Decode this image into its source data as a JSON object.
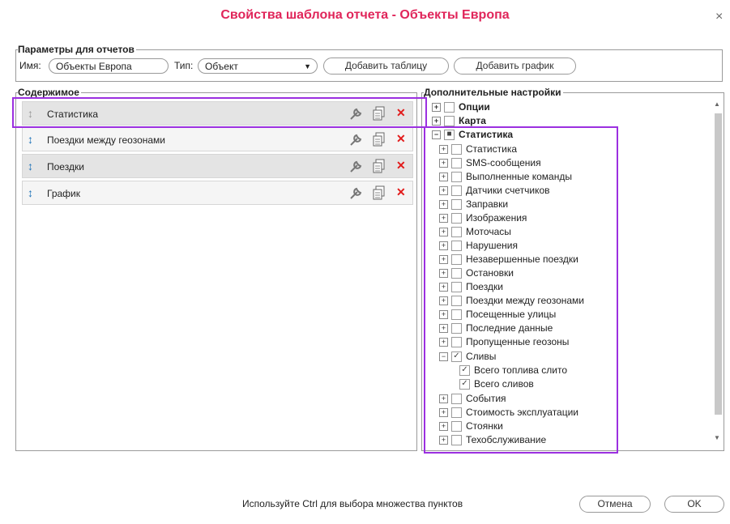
{
  "dialog": {
    "title": "Свойства шаблона отчета - Объекты Европа",
    "close": "×"
  },
  "params": {
    "legend": "Параметры для отчетов",
    "name_label": "Имя:",
    "name_value": "Объекты Европа",
    "type_label": "Тип:",
    "type_value": "Объект",
    "add_table": "Добавить таблицу",
    "add_chart": "Добавить график"
  },
  "content": {
    "legend": "Содержимое",
    "items": [
      {
        "label": "Статистика"
      },
      {
        "label": "Поездки между геозонами"
      },
      {
        "label": "Поездки"
      },
      {
        "label": "График"
      }
    ]
  },
  "extra": {
    "legend": "Дополнительные настройки",
    "opt_options": "Опции",
    "opt_map": "Карта",
    "opt_stats": "Статистика",
    "items": [
      "Статистика",
      "SMS-сообщения",
      "Выполненные команды",
      "Датчики счетчиков",
      "Заправки",
      "Изображения",
      "Моточасы",
      "Нарушения",
      "Незавершенные поездки",
      "Остановки",
      "Поездки",
      "Поездки между геозонами",
      "Посещенные улицы",
      "Последние данные",
      "Пропущенные геозоны"
    ],
    "drains": "Сливы",
    "drain_total_fuel": "Всего топлива слито",
    "drain_total": "Всего сливов",
    "after": [
      "События",
      "Стоимость эксплуатации",
      "Стоянки",
      "Техобслуживание"
    ]
  },
  "footer": {
    "hint": "Используйте Ctrl для выбора множества пунктов",
    "cancel": "Отмена",
    "ok": "OK"
  }
}
